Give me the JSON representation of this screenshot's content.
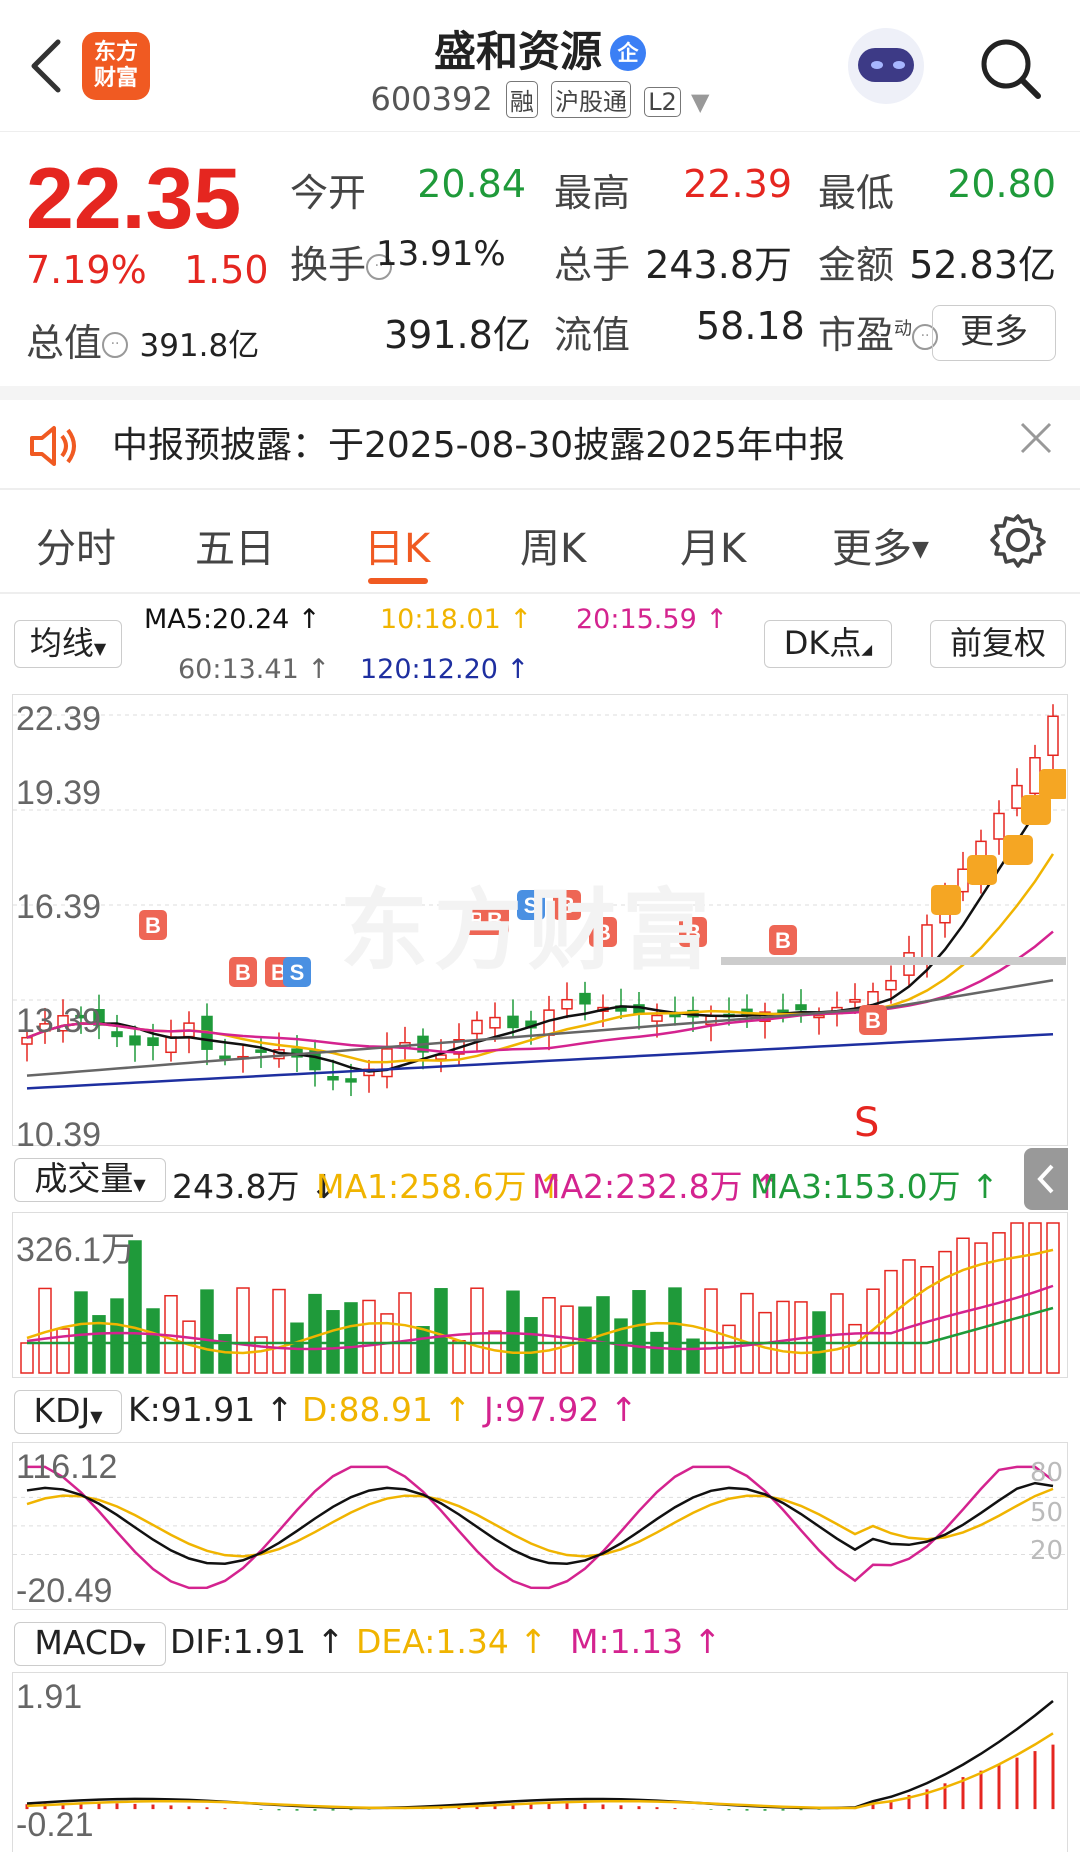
{
  "header": {
    "logo_text": "东方\n财富",
    "title": "盛和资源",
    "title_badge": "企",
    "code": "600392",
    "tags": [
      "融",
      "沪股通",
      "L2"
    ]
  },
  "quote": {
    "price": "22.35",
    "change_pct": "7.19%",
    "change_amt": "1.50",
    "fields": [
      {
        "label": "今开",
        "value": "20.84",
        "color": "#1f9a3a"
      },
      {
        "label": "最高",
        "value": "22.39",
        "color": "#e52620"
      },
      {
        "label": "最低",
        "value": "20.80",
        "color": "#1f9a3a"
      },
      {
        "label": "换手",
        "value": "13.91%",
        "color": "#222"
      },
      {
        "label": "总手",
        "value": "243.8万",
        "color": "#222"
      },
      {
        "label": "金额",
        "value": "52.83亿",
        "color": "#222"
      },
      {
        "label": "总值",
        "value": "391.8亿",
        "color": "#222"
      },
      {
        "label": "流值",
        "value": "391.8亿",
        "color": "#222"
      },
      {
        "label": "市盈",
        "value": "58.18",
        "color": "#222"
      }
    ],
    "pe_superscript": "动",
    "more_label": "更多"
  },
  "notice": {
    "text": "中报预披露：于2025-08-30披露2025年中报"
  },
  "tabs": [
    "分时",
    "五日",
    "日K",
    "周K",
    "月K",
    "更多"
  ],
  "active_tab": 2,
  "ma_bar": {
    "selector": "均线",
    "ma5": "MA5:20.24 ↑",
    "ma10": "10:18.01 ↑",
    "ma20": "20:15.59 ↑",
    "ma60": "60:13.41 ↑",
    "ma120": "120:12.20 ↑",
    "dk_label": "DK点",
    "adjust_label": "前复权"
  },
  "kline": {
    "y_labels": [
      "22.39",
      "19.39",
      "16.39",
      "13.39",
      "10.39"
    ],
    "watermark": "东方财富",
    "signal_s": "S"
  },
  "volume": {
    "selector": "成交量",
    "current": "243.8万 ↓",
    "ma1": "MA1:258.6万 ↑",
    "ma2": "MA2:232.8万 ↑",
    "ma3": "MA3:153.0万 ↑",
    "y_top": "326.1万"
  },
  "kdj": {
    "selector": "KDJ",
    "k": "K:91.91 ↑",
    "d": "D:88.91 ↑",
    "j": "J:97.92 ↑",
    "y_top": "116.12",
    "y_bottom": "-20.49",
    "levels": [
      "80",
      "50",
      "20"
    ]
  },
  "macd": {
    "selector": "MACD",
    "dif": "DIF:1.91 ↑",
    "dea": "DEA:1.34 ↑",
    "m": "M:1.13 ↑",
    "y_top": "1.91",
    "y_bottom": "-0.21"
  },
  "colors": {
    "up": "#e52620",
    "down": "#1f9a3a",
    "accent": "#f05a22",
    "ma5": "#111111",
    "ma10": "#f0b400",
    "ma20": "#d4238f",
    "ma60": "#666666",
    "ma120": "#1e2fa0"
  }
}
